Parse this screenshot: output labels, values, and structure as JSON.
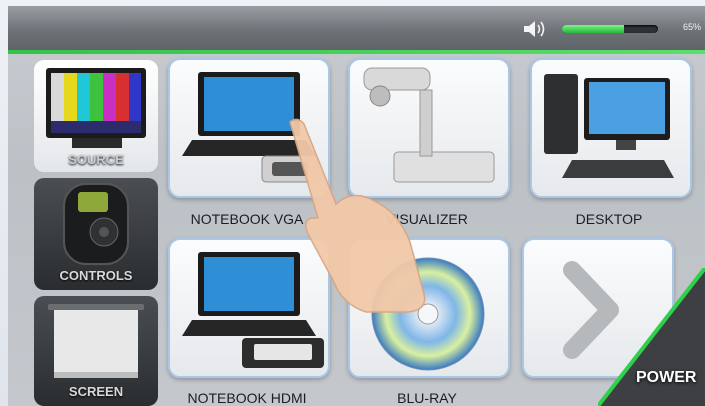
{
  "status": {
    "volume_level": 0.65,
    "volume_text": "65%"
  },
  "sidebar": {
    "items": [
      {
        "label": "SOURCE",
        "active": true
      },
      {
        "label": "CONTROLS",
        "active": false
      },
      {
        "label": "SCREEN",
        "active": false
      }
    ]
  },
  "sources": [
    {
      "label": "NOTEBOOK VGA",
      "icon": "laptop-vga-icon"
    },
    {
      "label": "VISUALIZER",
      "icon": "document-camera-icon"
    },
    {
      "label": "DESKTOP",
      "icon": "desktop-computer-icon"
    },
    {
      "label": "NOTEBOOK HDMI",
      "icon": "laptop-hdmi-icon"
    },
    {
      "label": "BLU-RAY",
      "icon": "bluray-disc-icon"
    },
    {
      "label": "",
      "icon": "next-arrow-icon"
    }
  ],
  "power": {
    "label": "POWER"
  },
  "colors": {
    "accent_green": "#33c24a",
    "tile_border": "#a9c7e6"
  }
}
